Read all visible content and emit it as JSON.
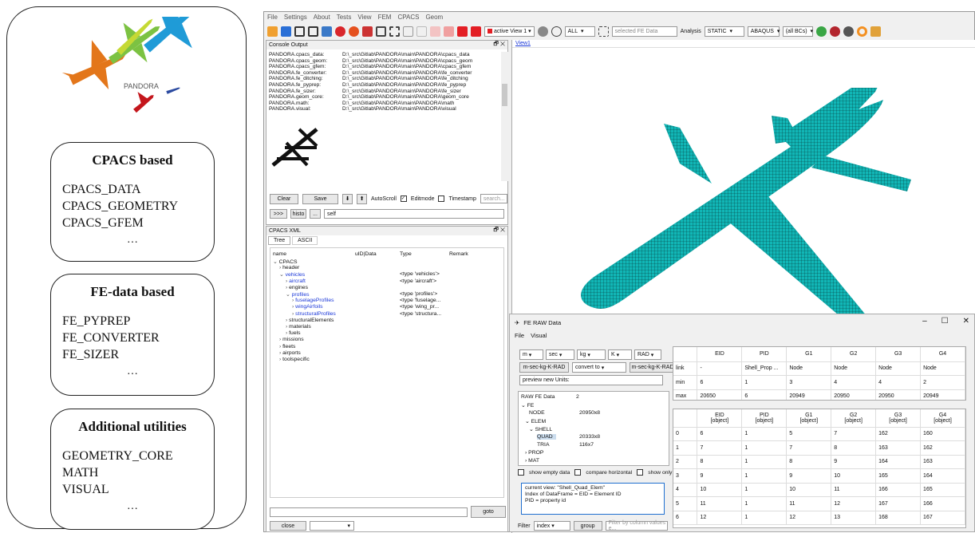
{
  "diagram": {
    "logo_text": "PANDORA",
    "cards": [
      {
        "title": "CPACS based",
        "items": [
          "CPACS_DATA",
          "CPACS_GEOMETRY",
          "CPACS_GFEM"
        ],
        "more": "…"
      },
      {
        "title": "FE-data based",
        "items": [
          "FE_PYPREP",
          "FE_CONVERTER",
          "FE_SIZER"
        ],
        "more": "…"
      },
      {
        "title": "Additional utilities",
        "items": [
          "GEOMETRY_CORE",
          "MATH",
          "VISUAL"
        ],
        "more": "…"
      }
    ]
  },
  "menu": [
    "File",
    "Settings",
    "About",
    "Tests",
    "View",
    "FEM",
    "CPACS",
    "Geom"
  ],
  "toolbar": {
    "view_select": "active View 1",
    "all_select": "ALL",
    "fe_data_placeholder": "selected FE Data",
    "analysis_label": "Analysis",
    "analysis_value": "STATIC",
    "solver": "ABAQUS",
    "bcs": "(all BCs)"
  },
  "console": {
    "title": "Console Output",
    "lines": [
      [
        "PANDORA.cpacs_data:",
        "D:\\_src\\Gitlab\\PANDORA\\main\\PANDORA\\cpacs_data"
      ],
      [
        "PANDORA.cpacs_geom:",
        "D:\\_src\\Gitlab\\PANDORA\\main\\PANDORA\\cpacs_geom"
      ],
      [
        "PANDORA.cpacs_gfem:",
        "D:\\_src\\Gitlab\\PANDORA\\main\\PANDORA\\cpacs_gfem"
      ],
      [
        "PANDORA.fe_converter:",
        "D:\\_src\\Gitlab\\PANDORA\\main\\PANDORA\\fe_converter"
      ],
      [
        "PANDORA.fe_ditching:",
        "D:\\_src\\Gitlab\\PANDORA\\main\\PANDORA\\fe_ditching"
      ],
      [
        "PANDORA.fe_pyprep:",
        "D:\\_src\\Gitlab\\PANDORA\\main\\PANDORA\\fe_pyprep"
      ],
      [
        "PANDORA.fe_sizer:",
        "D:\\_src\\Gitlab\\PANDORA\\main\\PANDORA\\fe_sizer"
      ],
      [
        "PANDORA.geom_core:",
        "D:\\_src\\Gitlab\\PANDORA\\main\\PANDORA\\geom_core"
      ],
      [
        "PANDORA.math:",
        "D:\\_src\\Gitlab\\PANDORA\\main\\PANDORA\\math"
      ],
      [
        "PANDORA.visual:",
        "D:\\_src\\Gitlab\\PANDORA\\main\\PANDORA\\visual"
      ]
    ],
    "clear": "Clear",
    "save": "Save",
    "autoscroll": "AutoScroll",
    "editmode": "Editmode",
    "timestamp": "Timestamp",
    "search_placeholder": "search...",
    "prompt": ">>>",
    "histo": "histo",
    "dots": "...",
    "command": "self"
  },
  "cpacs": {
    "title": "CPACS XML",
    "tabs": [
      "Tree",
      "ASCII"
    ],
    "columns": [
      "name",
      "uID|Data",
      "Type",
      "Remark"
    ],
    "tree": [
      {
        "t": "CPACS",
        "l": 0,
        "a": "v",
        "c": "",
        "type": ""
      },
      {
        "t": "header",
        "l": 1,
        "a": ">",
        "c": "",
        "type": ""
      },
      {
        "t": "vehicles",
        "l": 1,
        "a": "v",
        "c": "blue",
        "type": "<type 'vehicles'>"
      },
      {
        "t": "aircraft",
        "l": 2,
        "a": ">",
        "c": "blue",
        "type": "<type 'aircraft'>"
      },
      {
        "t": "engines",
        "l": 2,
        "a": ">",
        "c": "",
        "type": ""
      },
      {
        "t": "profiles",
        "l": 2,
        "a": "v",
        "c": "blue",
        "type": "<type 'profiles'>"
      },
      {
        "t": "fuselageProfiles",
        "l": 3,
        "a": ">",
        "c": "blue",
        "type": "<type 'fuselage..."
      },
      {
        "t": "wingAirfoils",
        "l": 3,
        "a": ">",
        "c": "blue",
        "type": "<type 'wing_pr..."
      },
      {
        "t": "structuralProfiles",
        "l": 3,
        "a": ">",
        "c": "blue",
        "type": "<type 'structura..."
      },
      {
        "t": "structuralElements",
        "l": 2,
        "a": ">",
        "c": "",
        "type": ""
      },
      {
        "t": "materials",
        "l": 2,
        "a": ">",
        "c": "",
        "type": ""
      },
      {
        "t": "fuels",
        "l": 2,
        "a": ">",
        "c": "",
        "type": ""
      },
      {
        "t": "missions",
        "l": 1,
        "a": ">",
        "c": "",
        "type": ""
      },
      {
        "t": "fleets",
        "l": 1,
        "a": ">",
        "c": "",
        "type": ""
      },
      {
        "t": "airports",
        "l": 1,
        "a": ">",
        "c": "",
        "type": ""
      },
      {
        "t": "toolspecific",
        "l": 1,
        "a": ">",
        "c": "",
        "type": ""
      }
    ],
    "goto": "goto",
    "close": "close"
  },
  "view": {
    "tab": "View1"
  },
  "raw": {
    "title": "FE RAW Data",
    "menu": [
      "File",
      "Visual"
    ],
    "units": [
      "m",
      "sec",
      "kg",
      "K",
      "RAD"
    ],
    "unit_sys": "m-sec-kg-K-RAD",
    "convert": "convert to",
    "unit_sys2": "m-sec-kg-K-RAD",
    "preview": "preview new Units:",
    "tree": [
      {
        "t": "RAW FE Data",
        "v": "2",
        "l": 0,
        "a": ""
      },
      {
        "t": "FE",
        "v": "",
        "l": 0,
        "a": "v"
      },
      {
        "t": "NODE",
        "v": "20950x8",
        "l": 2,
        "a": ""
      },
      {
        "t": "ELEM",
        "v": "",
        "l": 1,
        "a": "v"
      },
      {
        "t": "SHELL",
        "v": "",
        "l": 2,
        "a": "v"
      },
      {
        "t": "QUAD",
        "v": "20333x8",
        "l": 4,
        "a": "",
        "sel": true
      },
      {
        "t": "TRIA",
        "v": "116x7",
        "l": 4,
        "a": ""
      },
      {
        "t": "PROP",
        "v": "",
        "l": 1,
        "a": ">"
      },
      {
        "t": "MAT",
        "v": "",
        "l": 1,
        "a": ">"
      }
    ],
    "checks": [
      "show empty data",
      "compare horizontal",
      "show only diff"
    ],
    "info": [
      "current view: \"Shell_Quad_Elem\"",
      "",
      "Index of DataFrame = EID = Element ID",
      "PID = property id"
    ],
    "filter_label": "Filter",
    "filter_value": "index",
    "group": "group",
    "filter_placeholder": "Filter by column values e...",
    "top_headers": [
      "",
      "EID",
      "PID",
      "G1",
      "G2",
      "G3",
      "G4"
    ],
    "top_rows": [
      [
        "link",
        "-",
        "Shell_Prop ...",
        "Node",
        "Node",
        "Node",
        "Node"
      ],
      [
        "min",
        "6",
        "1",
        "3",
        "4",
        "4",
        "2"
      ],
      [
        "max",
        "20650",
        "6",
        "20949",
        "20950",
        "20950",
        "20949"
      ]
    ],
    "bot_headers": [
      "",
      "EID\n[object]",
      "PID\n[object]",
      "G1\n[object]",
      "G2\n[object]",
      "G3\n[object]",
      "G4\n[object]"
    ],
    "bot_rows": [
      [
        "0",
        "6",
        "1",
        "5",
        "7",
        "162",
        "160"
      ],
      [
        "1",
        "7",
        "1",
        "7",
        "8",
        "163",
        "162"
      ],
      [
        "2",
        "8",
        "1",
        "8",
        "9",
        "164",
        "163"
      ],
      [
        "3",
        "9",
        "1",
        "9",
        "10",
        "165",
        "164"
      ],
      [
        "4",
        "10",
        "1",
        "10",
        "11",
        "166",
        "165"
      ],
      [
        "5",
        "11",
        "1",
        "11",
        "12",
        "167",
        "166"
      ],
      [
        "6",
        "12",
        "1",
        "12",
        "13",
        "168",
        "167"
      ]
    ]
  }
}
